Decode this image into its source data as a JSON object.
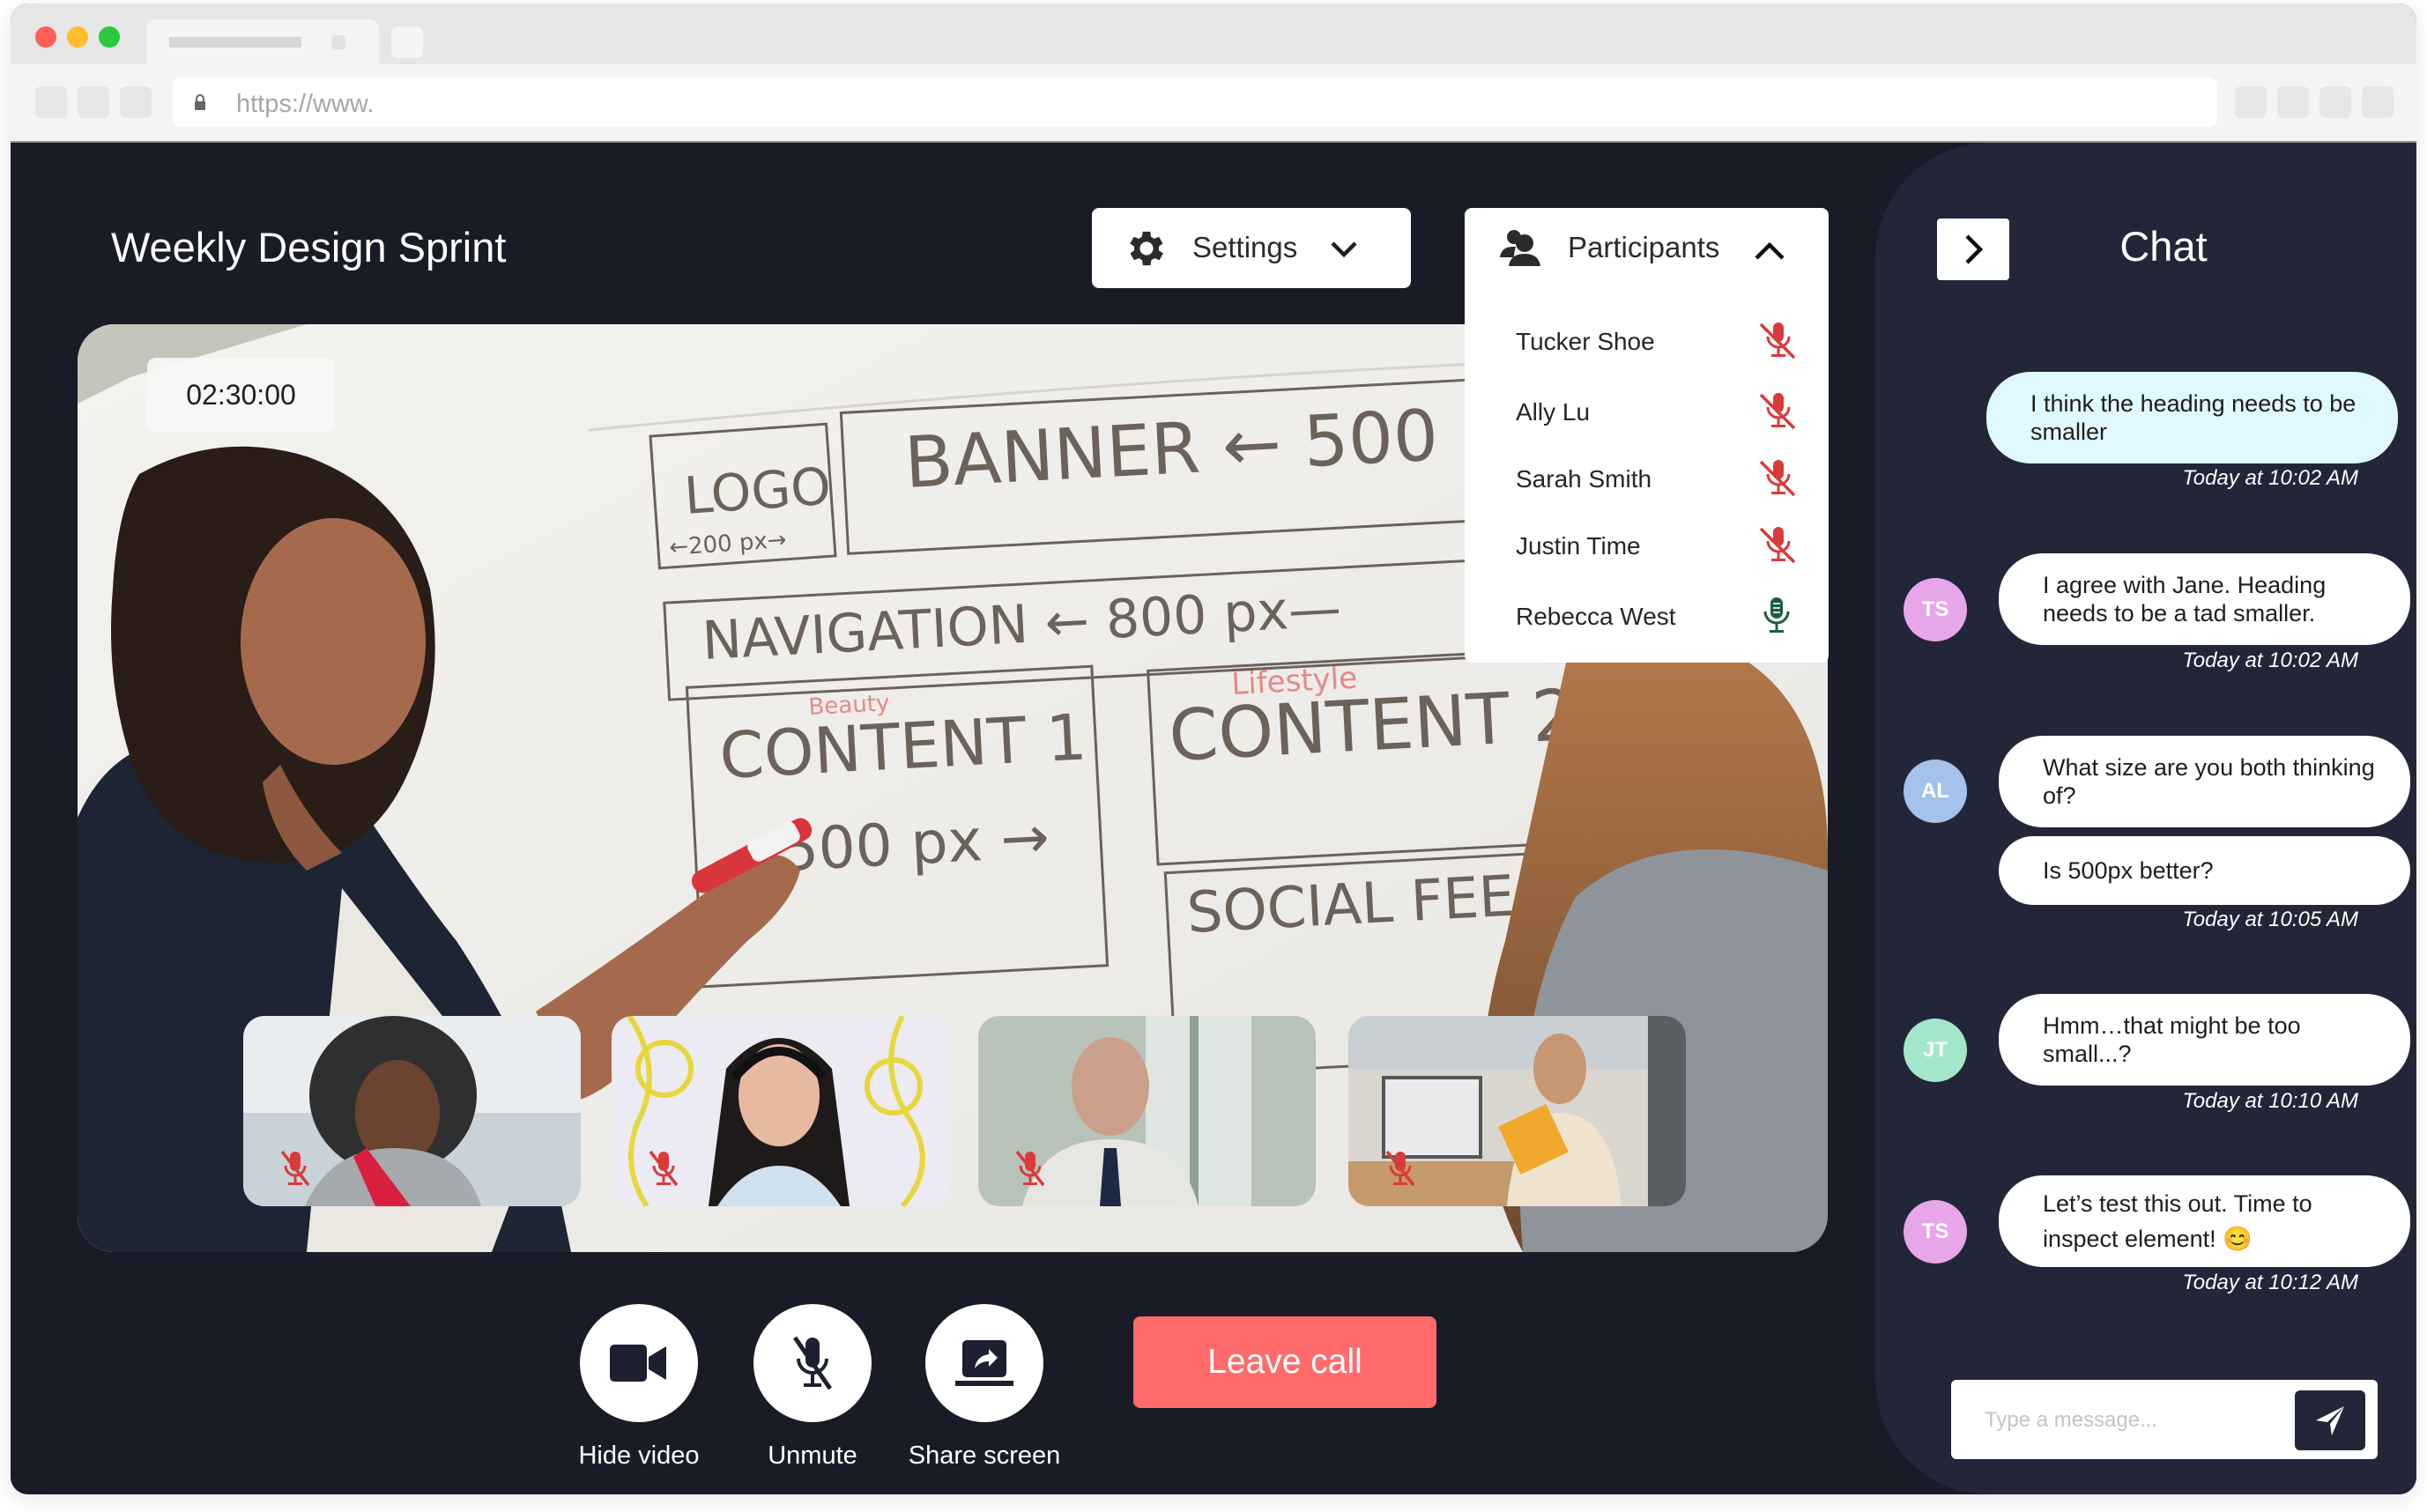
{
  "browser": {
    "url": "https://www.",
    "traffic_lights": {
      "close": "#ff5f57",
      "minimize": "#febc2e",
      "zoom": "#28c840"
    }
  },
  "header": {
    "title": "Weekly Design Sprint",
    "settings": {
      "label": "Settings",
      "icon": "gear-icon",
      "chevron": "chevron-down-icon"
    },
    "participants": {
      "label": "Participants",
      "icon": "users-icon",
      "chevron": "chevron-up-icon",
      "expanded": true
    }
  },
  "participants": [
    {
      "name": "Tucker Shoe",
      "mic": "muted"
    },
    {
      "name": "Ally Lu",
      "mic": "muted"
    },
    {
      "name": "Sarah Smith",
      "mic": "muted"
    },
    {
      "name": "Justin Time",
      "mic": "muted"
    },
    {
      "name": "Rebecca West",
      "mic": "active"
    }
  ],
  "video": {
    "timer": "02:30:00",
    "whiteboard_labels": [
      "LOGO",
      "←200 px→",
      "BANNER ← 500",
      "NAVIGATION ← 800 px—",
      "CONTENT 1",
      "Beauty",
      "500 px →",
      "CONTENT 2",
      "Lifestyle",
      "SOCIAL FEE"
    ],
    "thumbnails": [
      {
        "mic": "muted"
      },
      {
        "mic": "muted"
      },
      {
        "mic": "muted"
      },
      {
        "mic": "muted"
      }
    ]
  },
  "controls": {
    "hide_video": "Hide video",
    "unmute": "Unmute",
    "share_screen": "Share screen",
    "leave_call": "Leave call"
  },
  "chat": {
    "title": "Chat",
    "toggle_icon": "chevron-right-icon",
    "messages": [
      {
        "sender": "",
        "initials": "",
        "text": "I think the heading needs to be smaller",
        "time": "Today at 10:02 AM",
        "self": true
      },
      {
        "sender": "TS",
        "initials": "TS",
        "text": "I agree with Jane. Heading needs to be a tad smaller.",
        "time": "Today at 10:02 AM",
        "self": false
      },
      {
        "sender": "AL",
        "initials": "AL",
        "text": "What size are you both thinking of?",
        "time": "",
        "self": false
      },
      {
        "sender": "AL",
        "initials": "",
        "text": "Is 500px better?",
        "time": "Today at 10:05 AM",
        "self": false
      },
      {
        "sender": "JT",
        "initials": "JT",
        "text": "Hmm…that might be too small...?",
        "time": "Today at 10:10 AM",
        "self": false
      },
      {
        "sender": "TS",
        "initials": "TS",
        "text": "Let’s test this out. Time to inspect element! 😊",
        "time": "Today at 10:12 AM",
        "self": false
      }
    ],
    "avatar_colors": {
      "TS": "#e8a6ea",
      "AL": "#a4c2ec",
      "JT": "#a3e7cb"
    },
    "input_placeholder": "Type a message...",
    "send_icon": "send-icon"
  },
  "colors": {
    "app_bg": "#191c26",
    "chat_bg": "#232638",
    "leave": "#ff6b6b",
    "muted_mic": "#d93b3b",
    "active_mic": "#1d5e3f",
    "self_bubble": "#e0f8ff"
  }
}
